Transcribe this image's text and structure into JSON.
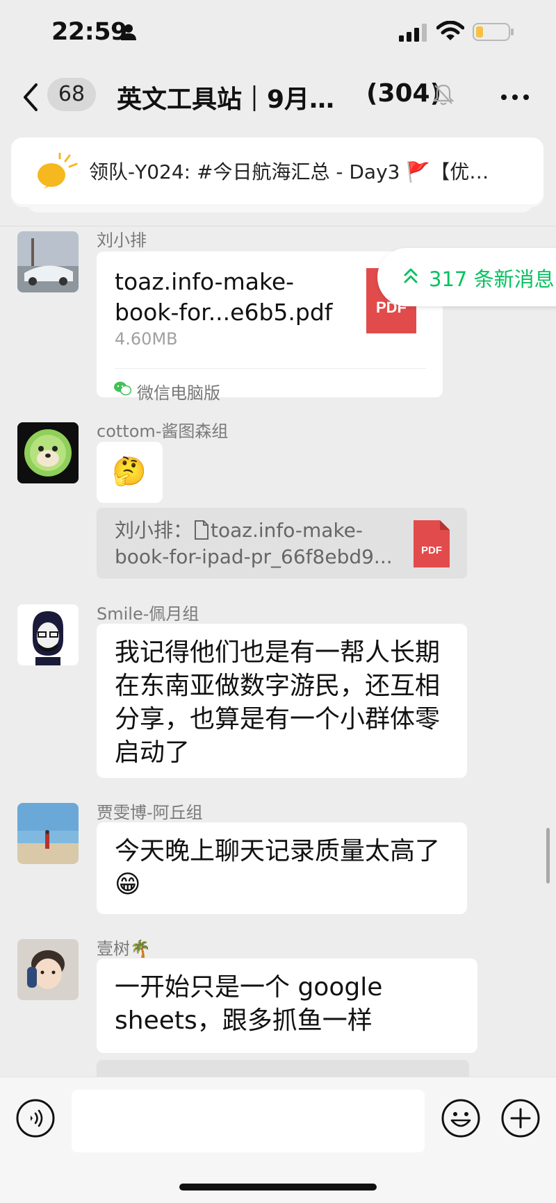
{
  "status_bar": {
    "time": "22:59"
  },
  "nav": {
    "unread_count": "68",
    "title": "英文工具站｜9月…",
    "member_count": "(304)"
  },
  "pinned": {
    "text": "领队-Y024: #今日航海汇总 - Day3 🚩【优…"
  },
  "new_messages": {
    "label": "317 条新消息"
  },
  "messages": [
    {
      "sender": "刘小排",
      "file": {
        "name": "toaz.info-make-book-for...e6b5.pdf",
        "size": "4.60MB",
        "source": "微信电脑版",
        "type_label": "PDF"
      }
    },
    {
      "sender": "cottom-酱图森组",
      "emoji": "🤔",
      "quote": {
        "author": "刘小排：",
        "line1": "toaz.info-make-",
        "line2": "book-for-ipad-pr_66f8ebd9...",
        "type_label": "PDF"
      }
    },
    {
      "sender": "Smile-佩月组",
      "text": "我记得他们也是有一帮人长期在东南亚做数字游民，还互相分享，也算是有一个小群体零启动了"
    },
    {
      "sender": "贾雯博-阿丘组",
      "text": "今天晚上聊天记录质量太高了😁"
    },
    {
      "sender": "壹树🌴",
      "text": "一开始只是一个 google sheets，跟多抓鱼一样"
    }
  ],
  "input": {
    "placeholder": ""
  },
  "colors": {
    "accent": "#07c160",
    "pdf_red": "#e24b4b",
    "background": "#ededed"
  }
}
